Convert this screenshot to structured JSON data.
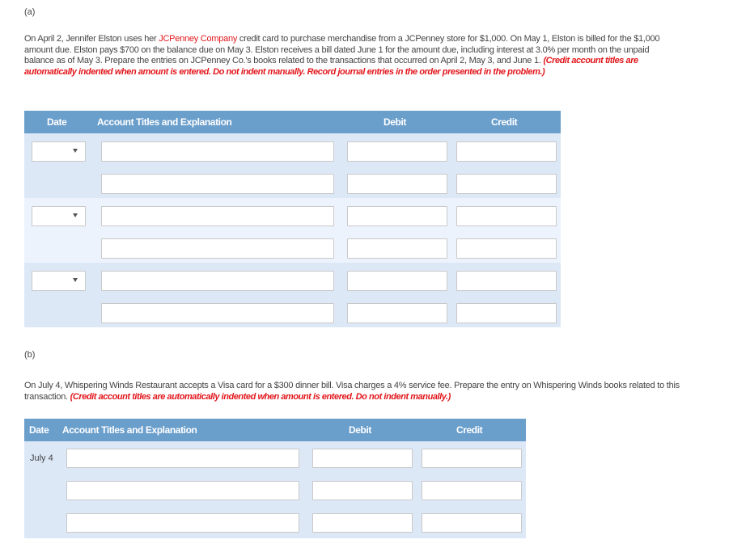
{
  "part_a": {
    "label": "(a)",
    "text_before_company": "On April 2, Jennifer Elston uses her ",
    "company": "JCPenney Company",
    "text_after_company": " credit card to purchase merchandise from a JCPenney store for $1,000. On May 1, Elston is billed for the $1,000 amount due. Elston pays $700 on the balance due on May 3. Elston receives a bill dated June 1 for the amount due, including interest at 3.0% per month on the unpaid balance as of May 3. Prepare the entries on JCPenney Co.'s books related to the transactions that occurred on April 2, May 3, and June 1. ",
    "note": "(Credit account titles are automatically indented when amount is entered. Do not indent manually. Record journal entries in the order presented in the problem.)",
    "table": {
      "headers": {
        "date": "Date",
        "account": "Account Titles and Explanation",
        "debit": "Debit",
        "credit": "Credit"
      },
      "entries": [
        {
          "date_selected": "",
          "lines": [
            {
              "account": "",
              "debit": "",
              "credit": ""
            },
            {
              "account": "",
              "debit": "",
              "credit": ""
            }
          ]
        },
        {
          "date_selected": "",
          "lines": [
            {
              "account": "",
              "debit": "",
              "credit": ""
            },
            {
              "account": "",
              "debit": "",
              "credit": ""
            }
          ]
        },
        {
          "date_selected": "",
          "lines": [
            {
              "account": "",
              "debit": "",
              "credit": ""
            },
            {
              "account": "",
              "debit": "",
              "credit": ""
            }
          ]
        }
      ]
    }
  },
  "part_b": {
    "label": "(b)",
    "text": "On July 4, Whispering Winds Restaurant accepts a Visa card for a $300 dinner bill. Visa charges a 4% service fee. Prepare the entry on Whispering Winds books related to this transaction. ",
    "note": "(Credit account titles are automatically indented when amount is entered. Do not indent manually.)",
    "table": {
      "headers": {
        "date": "Date",
        "account": "Account Titles and Explanation",
        "debit": "Debit",
        "credit": "Credit"
      },
      "entry": {
        "date": "July 4",
        "lines": [
          {
            "account": "",
            "debit": "",
            "credit": ""
          },
          {
            "account": "",
            "debit": "",
            "credit": ""
          },
          {
            "account": "",
            "debit": "",
            "credit": ""
          }
        ]
      }
    }
  },
  "colors": {
    "header_bg": "#6a9ecb",
    "row_dark": "#dde8f7",
    "row_light": "#ecf3fd",
    "accent_red": "#e2161b"
  }
}
